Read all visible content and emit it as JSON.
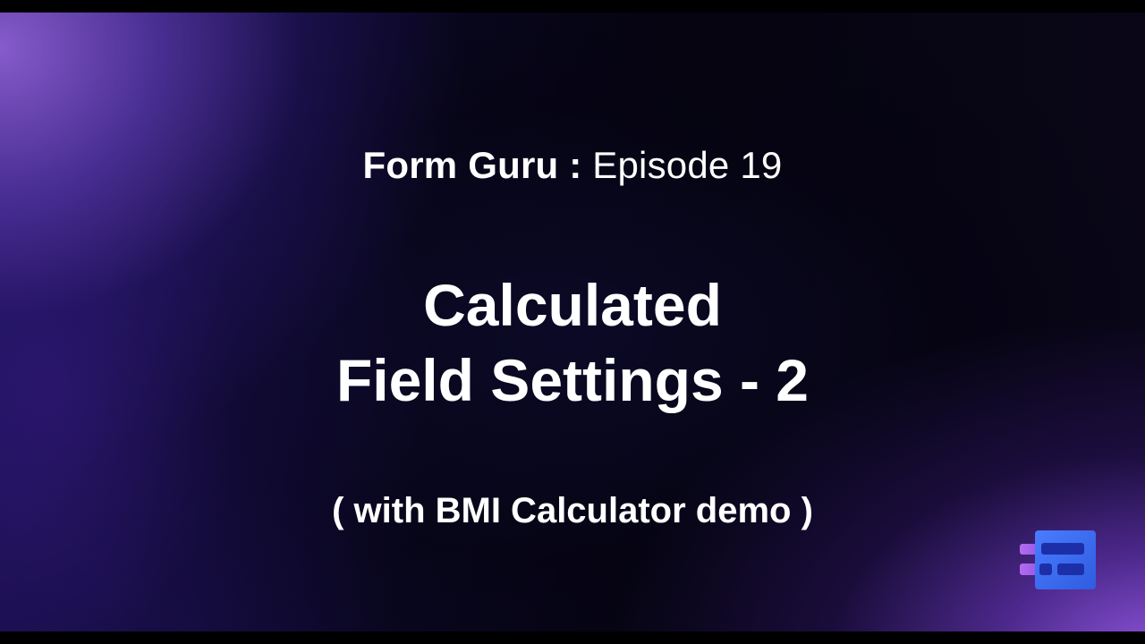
{
  "header": {
    "series_name": "Form Guru :",
    "episode": "Episode 19"
  },
  "title": {
    "line1": "Calculated",
    "line2": "Field Settings - 2"
  },
  "subtitle": "( with BMI Calculator demo )",
  "colors": {
    "background": "#000000",
    "glow_top_left": "#8c5fd2",
    "glow_bottom_right": "#965ae6",
    "text": "#ffffff",
    "logo_blue": "#3b6df0",
    "logo_purple": "#a05ae8"
  },
  "logo": {
    "icon": "form-builder-logo-icon"
  }
}
